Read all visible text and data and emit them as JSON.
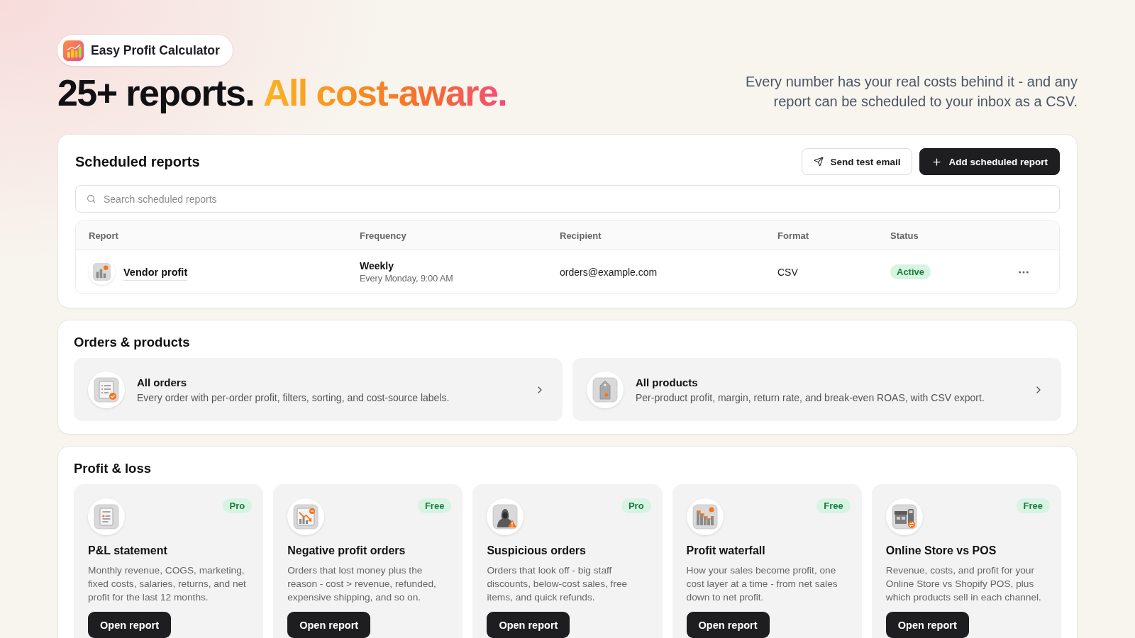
{
  "brand": {
    "name": "Easy Profit Calculator"
  },
  "hero": {
    "headline": "25+ reports.",
    "accent": "All cost-aware.",
    "subtitle": "Every number has your real costs behind it - and any report can be scheduled to your inbox as a CSV."
  },
  "scheduled_reports": {
    "title": "Scheduled reports",
    "buttons": [
      {
        "label": "Send test email",
        "kind": "secondary"
      },
      {
        "label": "Add scheduled report",
        "kind": "primary"
      }
    ],
    "search": {
      "placeholder": "Search scheduled reports"
    },
    "table": {
      "columns": [
        "Report",
        "Frequency",
        "Recipient",
        "Format",
        "Status"
      ],
      "rows": [
        {
          "report": "Vendor profit",
          "frequency": "Weekly",
          "schedule": "Every Monday, 9:00 AM",
          "recipient": "orders@example.com",
          "format": "CSV",
          "status": "Active"
        }
      ]
    }
  },
  "orders_products": {
    "title": "Orders & products",
    "items": [
      {
        "title": "All orders",
        "description": "Every order with per-order profit, filters, sorting, and cost-source labels."
      },
      {
        "title": "All products",
        "description": "Per-product profit, margin, return rate, and break-even ROAS, with CSV export."
      }
    ]
  },
  "profit_loss": {
    "title": "Profit & loss",
    "items": [
      {
        "title": "P&L statement",
        "badge": "Pro",
        "description": "Monthly revenue, COGS, marketing, fixed costs, salaries, returns, and net profit for the last 12 months.",
        "action": "Open report"
      },
      {
        "title": "Negative profit orders",
        "badge": "Free",
        "description": "Orders that lost money plus the reason - cost > revenue, refunded, expensive shipping, and so on.",
        "action": "Open report"
      },
      {
        "title": "Suspicious orders",
        "badge": "Pro",
        "description": "Orders that look off - big staff discounts, below-cost sales, free items, and quick refunds.",
        "action": "Open report"
      },
      {
        "title": "Profit waterfall",
        "badge": "Free",
        "description": "How your sales become profit, one cost layer at a time - from net sales down to net profit.",
        "action": "Open report"
      },
      {
        "title": "Online Store vs POS",
        "badge": "Free",
        "description": "Revenue, costs, and profit for your Online Store vs Shopify POS, plus which products sell in each channel.",
        "action": "Open report"
      }
    ]
  }
}
